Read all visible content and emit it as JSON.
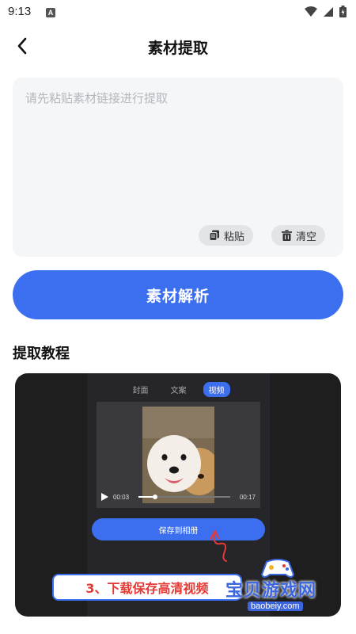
{
  "status_bar": {
    "time": "9:13",
    "notification_icon": "a-icon"
  },
  "header": {
    "title": "素材提取",
    "back_icon": "chevron-left-icon"
  },
  "input": {
    "placeholder": "请先粘贴素材链接进行提取",
    "value": ""
  },
  "actions": {
    "paste_label": "粘贴",
    "clear_label": "清空"
  },
  "primary_button": {
    "label": "素材解析"
  },
  "tutorial": {
    "title": "提取教程",
    "tabs": [
      "封面",
      "文案",
      "视频"
    ],
    "active_tab": "视频",
    "video": {
      "current_time": "00:03",
      "duration": "00:17",
      "progress": 0.18
    },
    "save_label": "保存到相册",
    "step_caption": "3、下载保存高清视频"
  },
  "watermark": {
    "text": "宝贝游戏网",
    "url": "baobeiy.com"
  },
  "colors": {
    "accent": "#3b6ff0",
    "card_bg": "#f5f6f8",
    "caption_red": "#e53935"
  }
}
